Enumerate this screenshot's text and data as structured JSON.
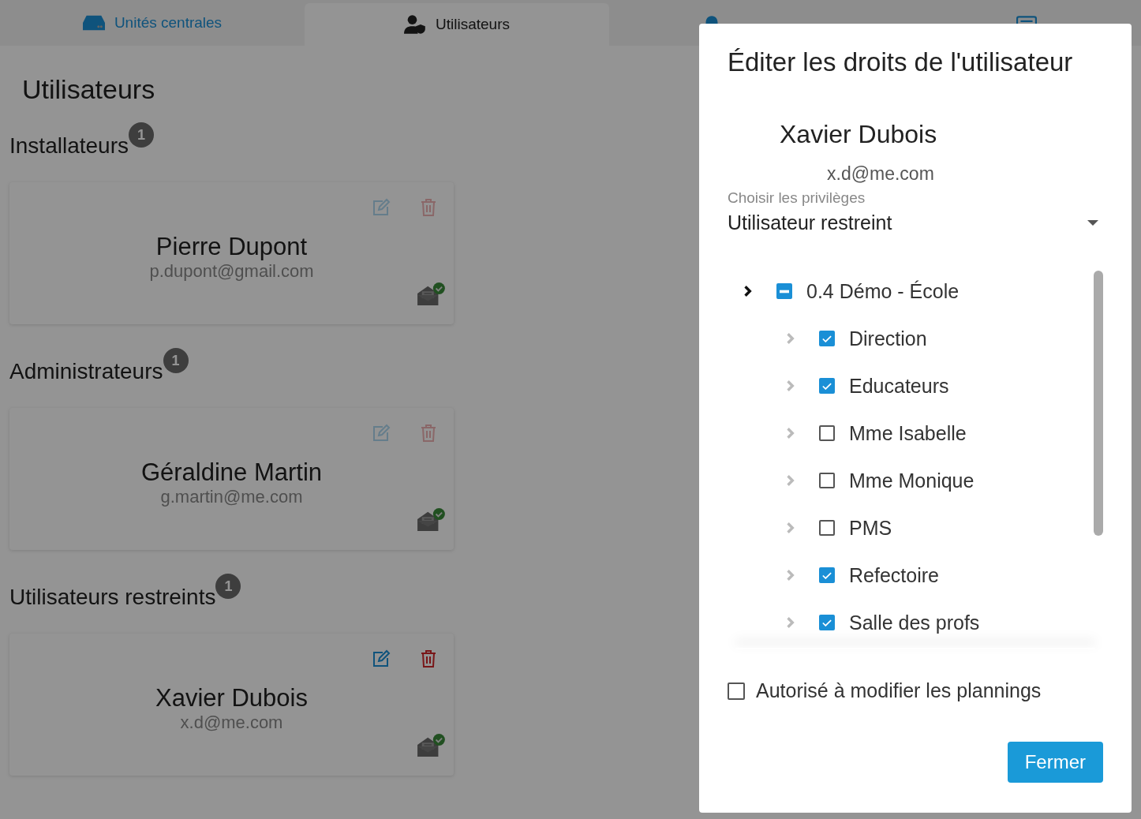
{
  "tabs": [
    {
      "label": "Unités centrales",
      "selected": false
    },
    {
      "label": "Utilisateurs",
      "selected": true
    },
    {
      "selected": false
    },
    {
      "selected": false
    }
  ],
  "page_title": "Utilisateurs",
  "groups": [
    {
      "title": "Installateurs",
      "count": "1",
      "users": [
        {
          "name": "Pierre Dupont",
          "email": "p.dupont@gmail.com",
          "disabled": true,
          "verified": true
        }
      ]
    },
    {
      "title": "Administrateurs",
      "count": "1",
      "users": [
        {
          "name": "Géraldine Martin",
          "email": "g.martin@me.com",
          "disabled": true,
          "verified": true
        }
      ]
    },
    {
      "title": "Utilisateurs restreints",
      "count": "1",
      "users": [
        {
          "name": "Xavier Dubois",
          "email": "x.d@me.com",
          "disabled": false,
          "verified": true
        }
      ]
    }
  ],
  "dialog": {
    "title": "Éditer les droits de l'utilisateur",
    "user_name": "Xavier Dubois",
    "user_email": "x.d@me.com",
    "privilege_label": "Choisir les privilèges",
    "privilege_value": "Utilisateur restreint",
    "tree": [
      {
        "label": "0.4 Démo - École",
        "indeterminate": true,
        "children": [
          {
            "label": "Direction",
            "checked": true
          },
          {
            "label": "Educateurs",
            "checked": true
          },
          {
            "label": "Mme Isabelle",
            "checked": false
          },
          {
            "label": "Mme Monique",
            "checked": false
          },
          {
            "label": "PMS",
            "checked": false
          },
          {
            "label": "Refectoire",
            "checked": true
          },
          {
            "label": "Salle des profs",
            "checked": true
          }
        ]
      }
    ],
    "planning_option": {
      "label": "Autorisé à modifier les plannings",
      "checked": false
    },
    "close_button": "Fermer"
  }
}
